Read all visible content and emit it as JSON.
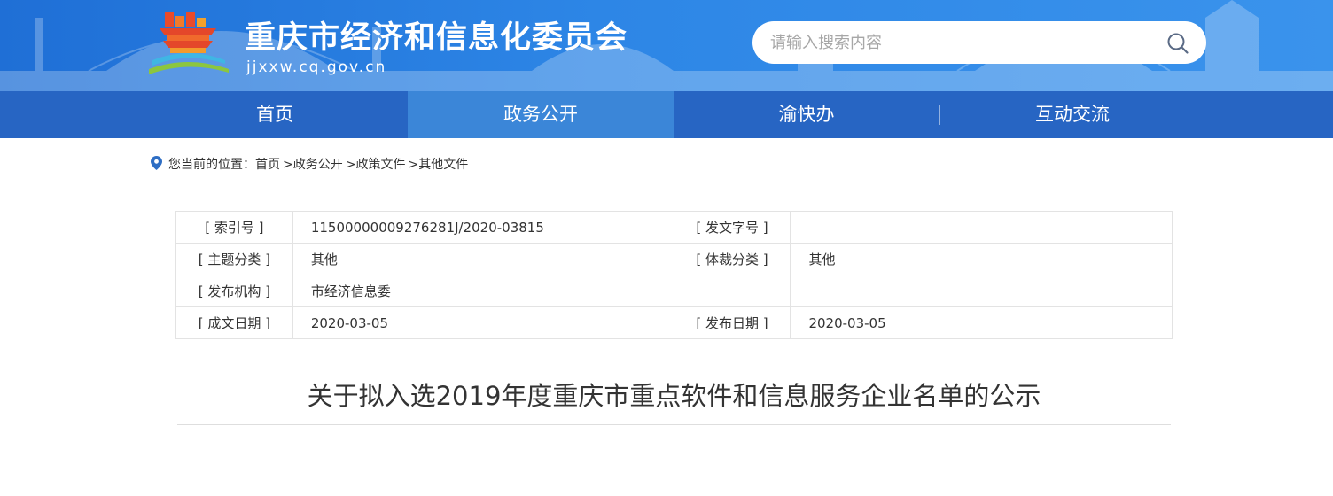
{
  "header": {
    "title": "重庆市经济和信息化委员会",
    "domain": "jjxxw.cq.gov.cn",
    "search_placeholder": "请输入搜索内容",
    "search_icon": "search-icon",
    "logo_icon": "temple-emblem-icon",
    "colors": {
      "header_blue": "#2d86e6",
      "nav_blue": "#2765c3",
      "nav_active": "#3b86d8"
    }
  },
  "nav": {
    "items": [
      {
        "label": "首页"
      },
      {
        "label": "政务公开",
        "active": true
      },
      {
        "label": "渝快办"
      },
      {
        "label": "互动交流"
      }
    ]
  },
  "breadcrumb": {
    "icon": "location-pin-icon",
    "prefix": "您当前的位置：",
    "items": [
      "首页",
      ">政务公开",
      ">政策文件",
      ">其他文件"
    ]
  },
  "info": {
    "rows": [
      {
        "l1": "[ 索引号 ]",
        "v1": "11500000009276281J/2020-03815",
        "l2": "[ 发文字号 ]",
        "v2": ""
      },
      {
        "l1": "[ 主题分类 ]",
        "v1": "其他",
        "l2": "[ 体裁分类 ]",
        "v2": "其他"
      },
      {
        "l1": "[ 发布机构 ]",
        "v1": "市经济信息委",
        "l2": "",
        "v2": ""
      },
      {
        "l1": "[ 成文日期 ]",
        "v1": "2020-03-05",
        "l2": "[ 发布日期 ]",
        "v2": "2020-03-05"
      }
    ]
  },
  "document": {
    "title": "关于拟入选2019年度重庆市重点软件和信息服务企业名单的公示"
  }
}
